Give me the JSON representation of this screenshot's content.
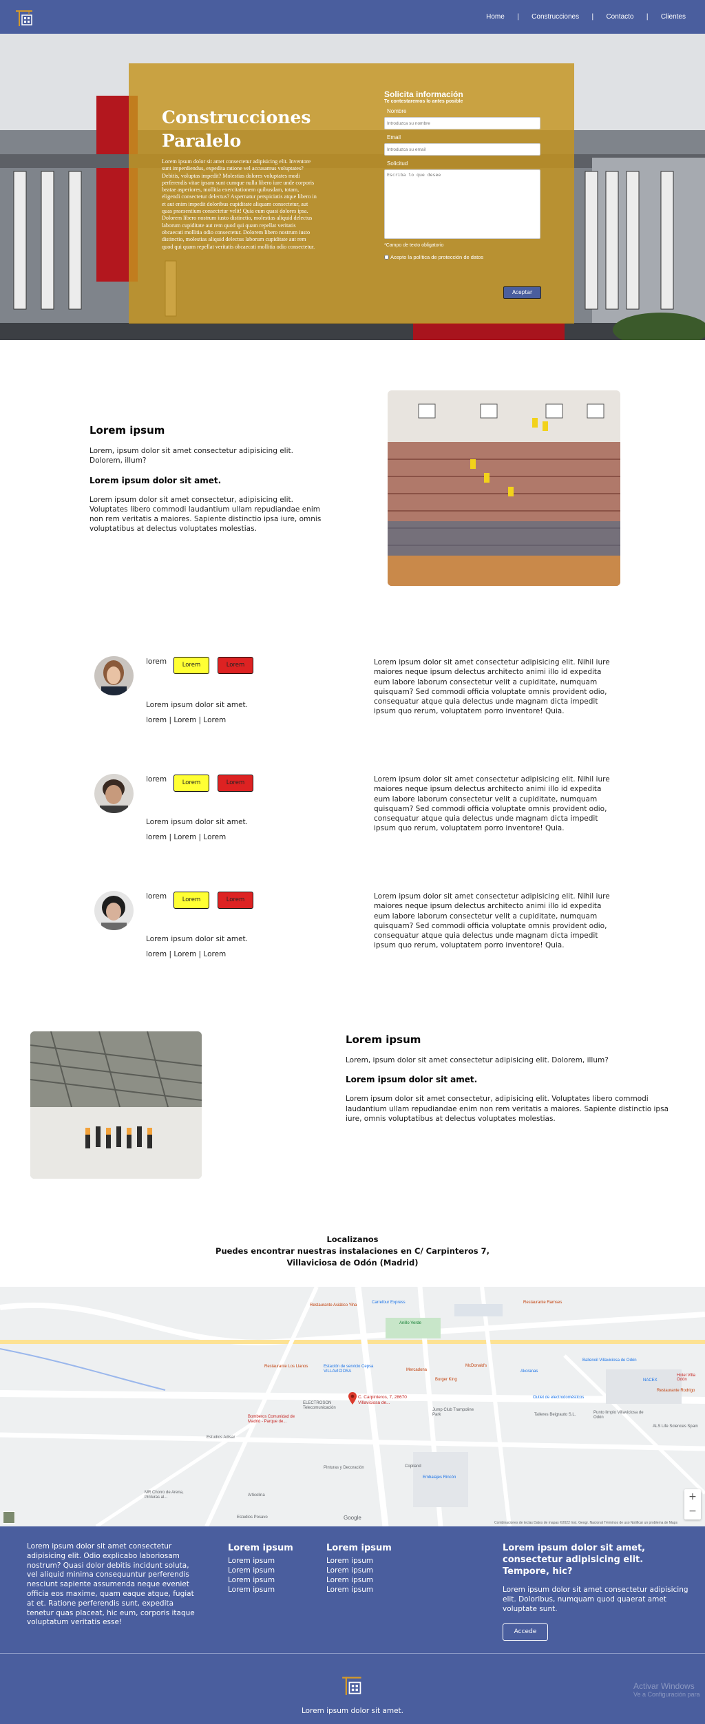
{
  "nav": {
    "links": [
      "Home",
      "Construcciones",
      "Contacto",
      "Clientes"
    ],
    "separator": "|"
  },
  "hero": {
    "title_line1": "Construcciones",
    "title_line2": "Paralelo",
    "text": "Lorem ipsum dolor sit amet consectetur adipisicing elit. Inventore sunt imperdiendus, expedita ratione vel accusamus voluptates? Debitis, voluptas impedit? Molestias dolores voluptates modi perferendis vitae ipsam sunt cumque nulla libero iure unde corporis beatae asperiores, mollitia exercitationem quibusdam, totam, eligendi consectetur delectus? Aspernatur perspiciatis atque libero in et aut enim impedit doloribus cupiditate aliquam consectetur, aut quas praesentium consectetur velit! Quia eum quasi dolores ipsa. Dolorem libero nostrum iusto distinctio, molestias aliquid delectus laborum cupiditate aut rem quod qui quam repellat veritatis obcaecati mollitia odio consectetur. Dolorem libero nostrum iusto distinctio, molestias aliquid delectus laborum cupiditate aut rem quod qui quam repellat veritatis obcaecati mollitia odio consectetur.",
    "form": {
      "title": "Solicita información",
      "subtitle": "Te contestaremos lo antes posible",
      "name_label": "Nombre",
      "name_placeholder": "Introduzca su nombre",
      "email_label": "Email",
      "email_placeholder": "Introduzca su email",
      "request_label": "Solicitud",
      "request_placeholder": "Escriba lo que desee",
      "required_note": "*Campo de texto obligatorio",
      "privacy_label": "Acepto la política de protección de datos",
      "submit_label": "Aceptar"
    }
  },
  "intro": {
    "title": "Lorem ipsum",
    "lead": "Lorem, ipsum dolor sit amet consectetur adipisicing elit. Dolorem, illum?",
    "subtitle": "Lorem ipsum dolor sit amet.",
    "body": "Lorem ipsum dolor sit amet consectetur, adipisicing elit. Voluptates libero commodi laudantium ullam repudiandae enim non rem veritatis a maiores. Sapiente distinctio ipsa iure, omnis voluptatibus at delectus voluptates molestias."
  },
  "testimonials": [
    {
      "name": "lorem",
      "yellow_button": "Lorem",
      "red_button": "Lorem",
      "line": "Lorem ipsum dolor sit amet.",
      "links": "lorem | Lorem | Lorem",
      "text": "Lorem ipsum dolor sit amet consectetur adipisicing elit. Nihil iure maiores neque ipsum delectus architecto animi illo id expedita eum labore laborum consectetur velit a cupiditate, numquam quisquam? Sed commodi officia voluptate omnis provident odio, consequatur atque quia delectus unde magnam dicta impedit ipsum quo rerum, voluptatem porro inventore! Quia."
    },
    {
      "name": "lorem",
      "yellow_button": "Lorem",
      "red_button": "Lorem",
      "line": "Lorem ipsum dolor sit amet.",
      "links": "lorem | Lorem | Lorem",
      "text": "Lorem ipsum dolor sit amet consectetur adipisicing elit. Nihil iure maiores neque ipsum delectus architecto animi illo id expedita eum labore laborum consectetur velit a cupiditate, numquam quisquam? Sed commodi officia voluptate omnis provident odio, consequatur atque quia delectus unde magnam dicta impedit ipsum quo rerum, voluptatem porro inventore! Quia."
    },
    {
      "name": "lorem",
      "yellow_button": "Lorem",
      "red_button": "Lorem",
      "line": "Lorem ipsum dolor sit amet.",
      "links": "lorem | Lorem | Lorem",
      "text": "Lorem ipsum dolor sit amet consectetur adipisicing elit. Nihil iure maiores neque ipsum delectus architecto animi illo id expedita eum labore laborum consectetur velit a cupiditate, numquam quisquam? Sed commodi officia voluptate omnis provident odio, consequatur atque quia delectus unde magnam dicta impedit ipsum quo rerum, voluptatem porro inventore! Quia."
    }
  ],
  "second": {
    "title": "Lorem ipsum",
    "lead": "Lorem, ipsum dolor sit amet consectetur adipisicing elit. Dolorem, illum?",
    "subtitle": "Lorem ipsum dolor sit amet.",
    "body": "Lorem ipsum dolor sit amet consectetur, adipisicing elit. Voluptates libero commodi laudantium ullam repudiandae enim non rem veritatis a maiores. Sapiente distinctio ipsa iure, omnis voluptatibus at delectus voluptates molestias."
  },
  "location": {
    "title": "Localizanos",
    "line1": "Puedes encontrar nuestras instalaciones en C/ Carpinteros 7,",
    "line2": "Villaviciosa de Odón (Madrid)"
  },
  "map": {
    "marker_label": "C. Carpinteros, 7, 28670 Villaviciosa de...",
    "attribution": "Combinaciones de teclas   Datos de mapas ©2022 Inst. Geogr. Nacional   Términos de uso   Notificar un problema de Maps",
    "zoom_in": "+",
    "zoom_out": "−",
    "google": "Google",
    "places": [
      "Restaurante Asiático Yiha",
      "Estación de servicio Cepsa VILLAVICIOSA",
      "Restaurante Los Llanos",
      "Mercadona",
      "Burger King",
      "McDonald's",
      "Akoranas",
      "Ballenoil Villaviciosa de Odón",
      "NACEX",
      "Outlet de electrodomésticos",
      "Talleres Beigrauto S.L.",
      "Punto limpio Villaviciosa de Odón",
      "ALS Life Sciences Spain",
      "Jump Club Trampoline Park",
      "ELECTROSON Telecomunicación",
      "Bomberos Comunidad de Madrid - Parque de...",
      "Estudios Adisar",
      "Copiland",
      "Embalajes Rincón",
      "Estudios Posavo",
      "MR Chorro de Arena, Pinturas al...",
      "Articolina",
      "Anillo Verde",
      "Carrefour Express",
      "Restaurante Ramses",
      "Hotel Villa Odón",
      "Restaurante Rodrigo",
      "Pinturas y Decoración"
    ]
  },
  "footer": {
    "about": "Lorem ipsum dolor sit amet consectetur adipisicing elit. Odio explicabo laboriosam nostrum? Quasi dolor debitis incidunt soluta, vel aliquid minima consequuntur perferendis nesciunt sapiente assumenda neque eveniet officia eos maxime, quam eaque atque, fugiat at et. Ratione perferendis sunt, expedita tenetur quas placeat, hic eum, corporis itaque voluptatum veritatis esse!",
    "col1_title": "Lorem ipsum",
    "col1_items": [
      "Lorem ipsum",
      "Lorem ipsum",
      "Lorem ipsum",
      "Lorem ipsum"
    ],
    "col2_title": "Lorem ipsum",
    "col2_items": [
      "Lorem ipsum",
      "Lorem ipsum",
      "Lorem ipsum",
      "Lorem ipsum"
    ],
    "cta_title": "Lorem ipsum dolor sit amet, consectetur adipisicing elit. Tempore, hic?",
    "cta_text": "Lorem ipsum dolor sit amet consectetur adipisicing elit. Doloribus, numquam quod quaerat amet voluptate sunt.",
    "cta_button": "Accede",
    "bottom_text": "Lorem ipsum dolor sit amet.",
    "watermark_line1": "Activar Windows",
    "watermark_line2": "Ve a Configuración para"
  },
  "colors": {
    "nav_bg": "#4a5e9e",
    "overlay": "#c4941e",
    "yellow_button": "#ffff33",
    "red_button": "#dd2222"
  }
}
